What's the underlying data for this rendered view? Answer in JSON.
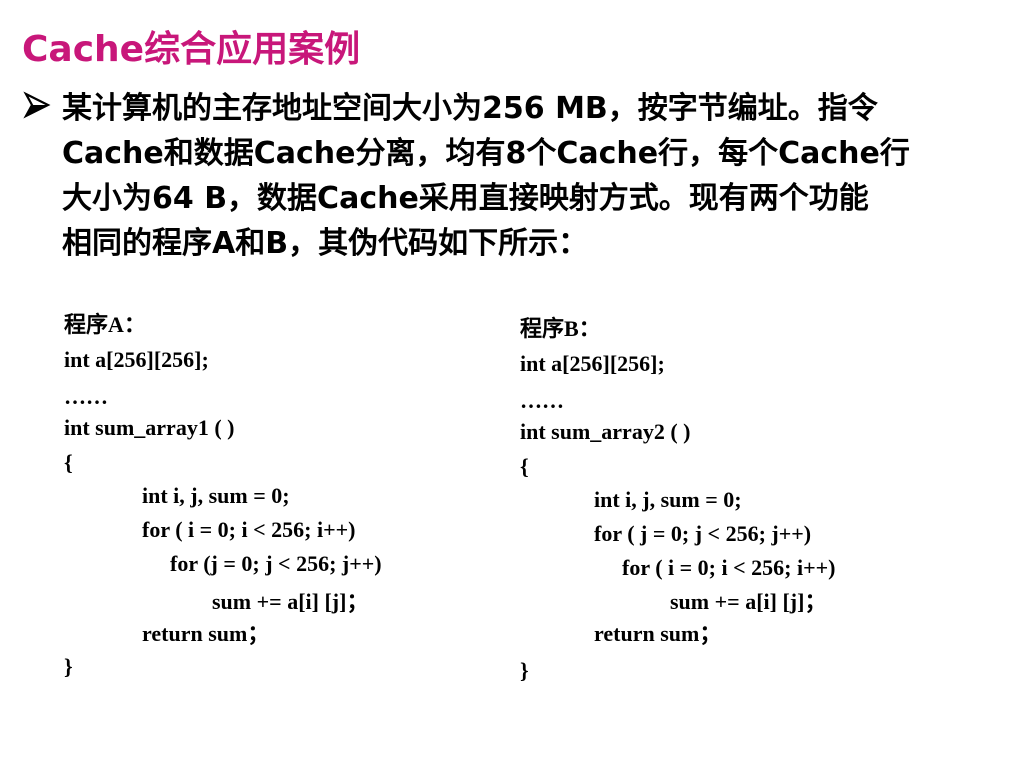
{
  "colors": {
    "title": "#c8177a",
    "text": "#000000",
    "background": "#ffffff"
  },
  "title": "Cache综合应用案例",
  "bullet": {
    "icon": "arrow-bullet-icon",
    "lines": [
      "某计算机的主存地址空间大小为256 MB，按字节编址。指令",
      "Cache和数据Cache分离，均有8个Cache行，每个Cache行",
      "大小为64 B，数据Cache采用直接映射方式。现有两个功能",
      "相同的程序A和B，其伪代码如下所示："
    ]
  },
  "program_a": {
    "lines": [
      "程序A：",
      "int a[256][256];",
      "……",
      "int sum_array1 ( )",
      "{",
      "int i, j, sum = 0;",
      "for ( i = 0; i < 256; i++)",
      "for (j = 0; j < 256; j++)",
      "sum += a[i] [j]；",
      "return sum；",
      "}"
    ]
  },
  "program_b": {
    "lines": [
      "程序B：",
      "int a[256][256];",
      "……",
      "int sum_array2 ( )",
      "{",
      "int i, j, sum = 0;",
      "for ( j = 0; j < 256; j++)",
      "for ( i = 0; i < 256; i++)",
      "sum += a[i] [j]；",
      "return sum；",
      "}"
    ]
  }
}
